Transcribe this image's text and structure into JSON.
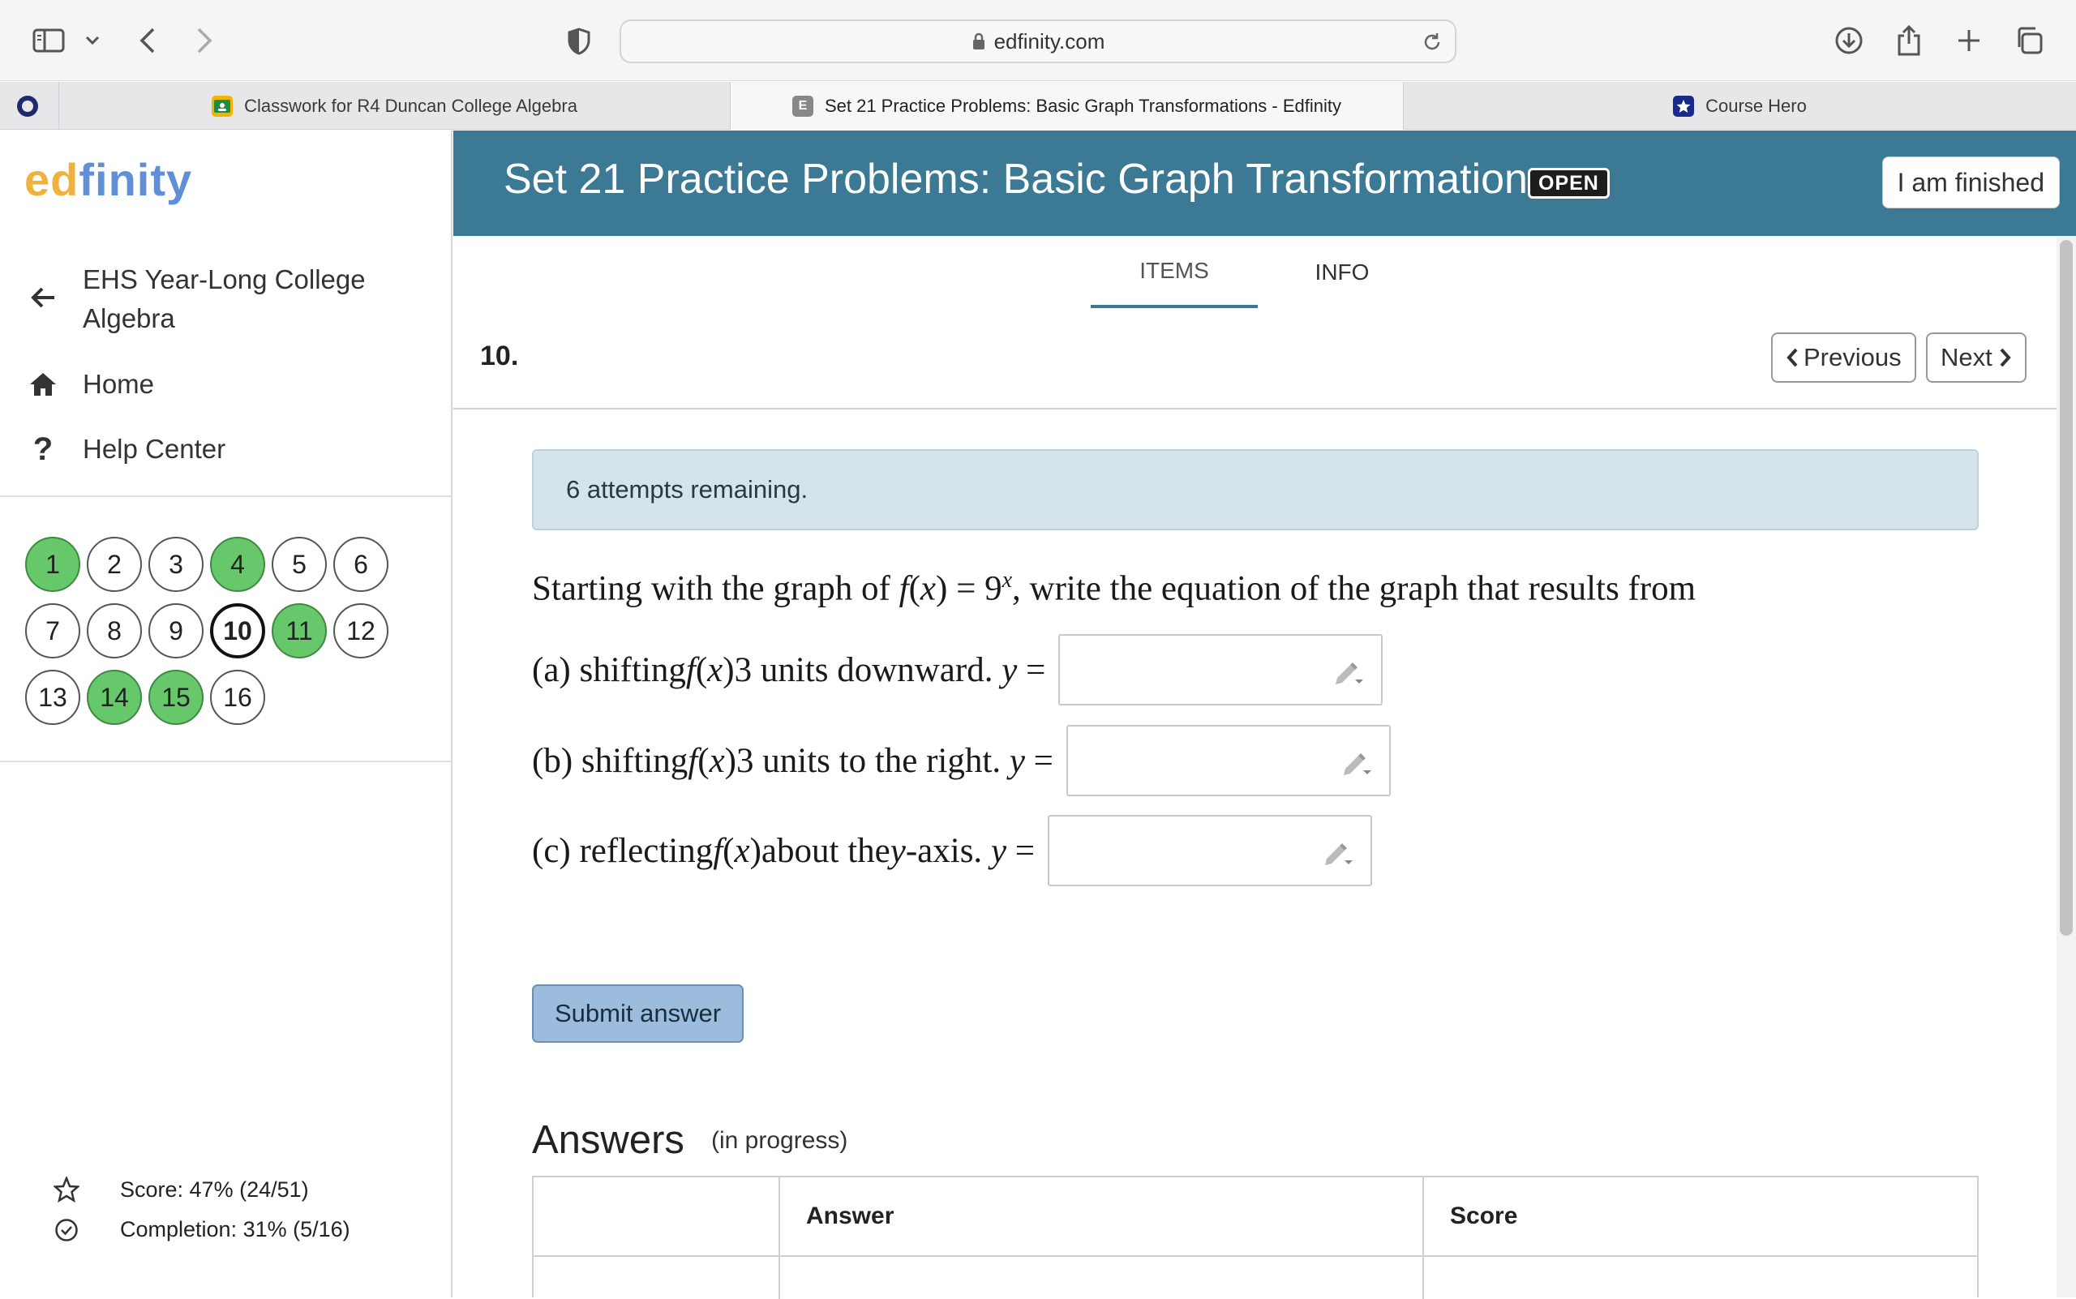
{
  "browser": {
    "url": "edfinity.com",
    "tabs": [
      {
        "label": "Classwork for R4 Duncan College Algebra",
        "favicon": "google-classroom-icon"
      },
      {
        "label": "Set 21 Practice Problems: Basic Graph Transformations - Edfinity",
        "favicon": "edfinity-icon",
        "favicon_letter": "E"
      },
      {
        "label": "Course Hero",
        "favicon": "course-hero-icon"
      }
    ]
  },
  "sidebar": {
    "logo_part1": "ed",
    "logo_part2": "finity",
    "course_line1": "EHS Year-Long College",
    "course_line2": "Algebra",
    "home_label": "Home",
    "help_label": "Help Center",
    "questions": [
      {
        "n": "1",
        "done": true
      },
      {
        "n": "2",
        "done": false
      },
      {
        "n": "3",
        "done": false
      },
      {
        "n": "4",
        "done": true
      },
      {
        "n": "5",
        "done": false
      },
      {
        "n": "6",
        "done": false
      },
      {
        "n": "7",
        "done": false
      },
      {
        "n": "8",
        "done": false
      },
      {
        "n": "9",
        "done": false
      },
      {
        "n": "10",
        "done": false,
        "current": true
      },
      {
        "n": "11",
        "done": true
      },
      {
        "n": "12",
        "done": false
      },
      {
        "n": "13",
        "done": false
      },
      {
        "n": "14",
        "done": true
      },
      {
        "n": "15",
        "done": true
      },
      {
        "n": "16",
        "done": false
      }
    ],
    "score": "Score: 47% (24/51)",
    "completion": "Completion: 31% (5/16)"
  },
  "header": {
    "title": "Set 21 Practice Problems: Basic Graph Transformations",
    "status_badge": "OPEN",
    "finished_button": "I am finished"
  },
  "page_tabs": {
    "items": "ITEMS",
    "info": "INFO"
  },
  "item": {
    "number": "10.",
    "previous_label": "Previous",
    "next_label": "Next"
  },
  "attempts": "6 attempts remaining.",
  "question": {
    "intro_before": "Starting with the graph of ",
    "intro_after": ", write the equation of the graph that results from",
    "function_base": "9",
    "function_exp": "x",
    "parts": [
      {
        "label": "(a) shifting ",
        "text": " 3 units downward. ",
        "value": ""
      },
      {
        "label": "(b) shifting ",
        "text": " 3 units to the right. ",
        "value": ""
      },
      {
        "label": "(c) reflecting ",
        "text": " about the ",
        "axis": "y",
        "text2": "-axis. ",
        "value": ""
      }
    ]
  },
  "submit_label": "Submit answer",
  "answers": {
    "heading": "Answers",
    "status": "(in progress)",
    "columns": [
      "",
      "Answer",
      "Score"
    ]
  },
  "colors": {
    "banner": "#3b7994",
    "done_question": "#67c76b",
    "attempts_bg": "#d5e3ea",
    "submit_bg": "#9bbcdc",
    "logo_ed": "#f0b23c",
    "logo_finity": "#5f8fd6"
  }
}
